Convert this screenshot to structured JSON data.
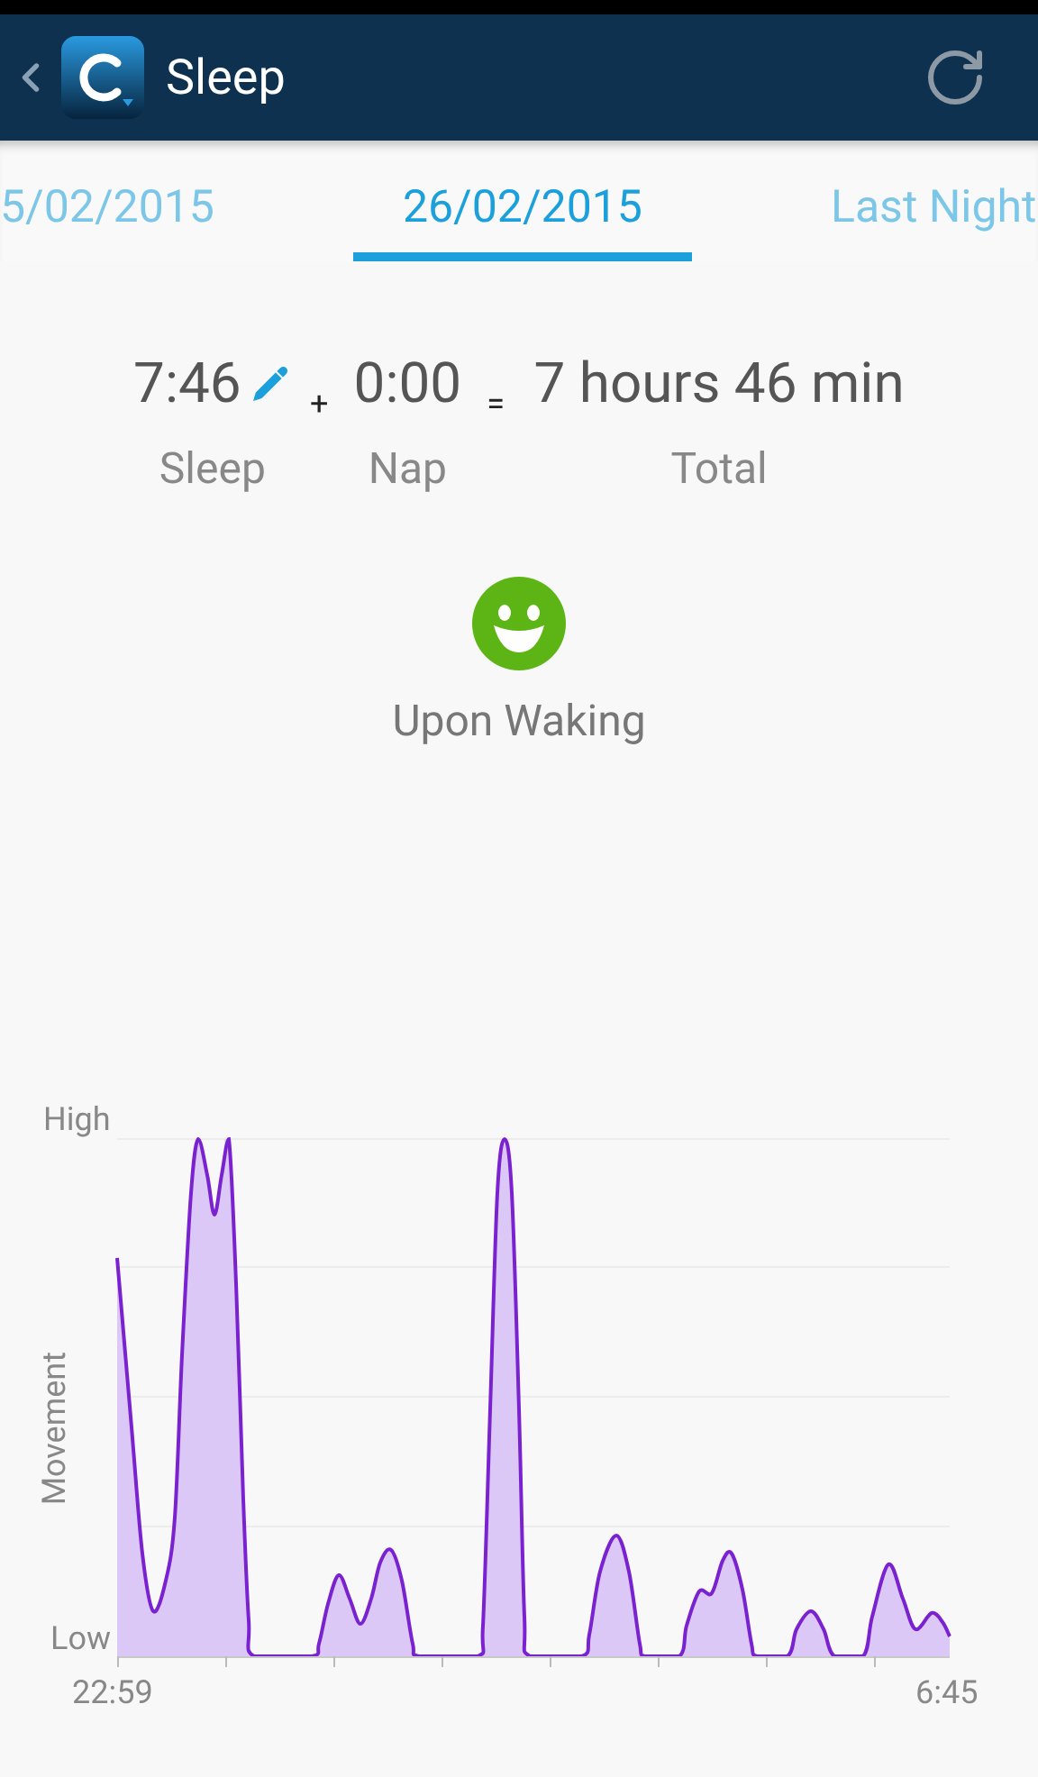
{
  "header": {
    "title": "Sleep"
  },
  "tabs": [
    {
      "label": "5/02/2015",
      "selected": false
    },
    {
      "label": "26/02/2015",
      "selected": true
    },
    {
      "label": "Last Night",
      "selected": false
    }
  ],
  "summary": {
    "sleep": {
      "value": "7:46",
      "label": "Sleep"
    },
    "plus": "+",
    "nap": {
      "value": "0:00",
      "label": "Nap"
    },
    "equals": "=",
    "total": {
      "value": "7 hours 46 min",
      "label": "Total"
    }
  },
  "mood": {
    "kind": "happy",
    "label": "Upon Waking"
  },
  "chart": {
    "y_label": "Movement",
    "y_top": "High",
    "y_bottom": "Low",
    "x_start": "22:59",
    "x_end": "6:45"
  }
}
